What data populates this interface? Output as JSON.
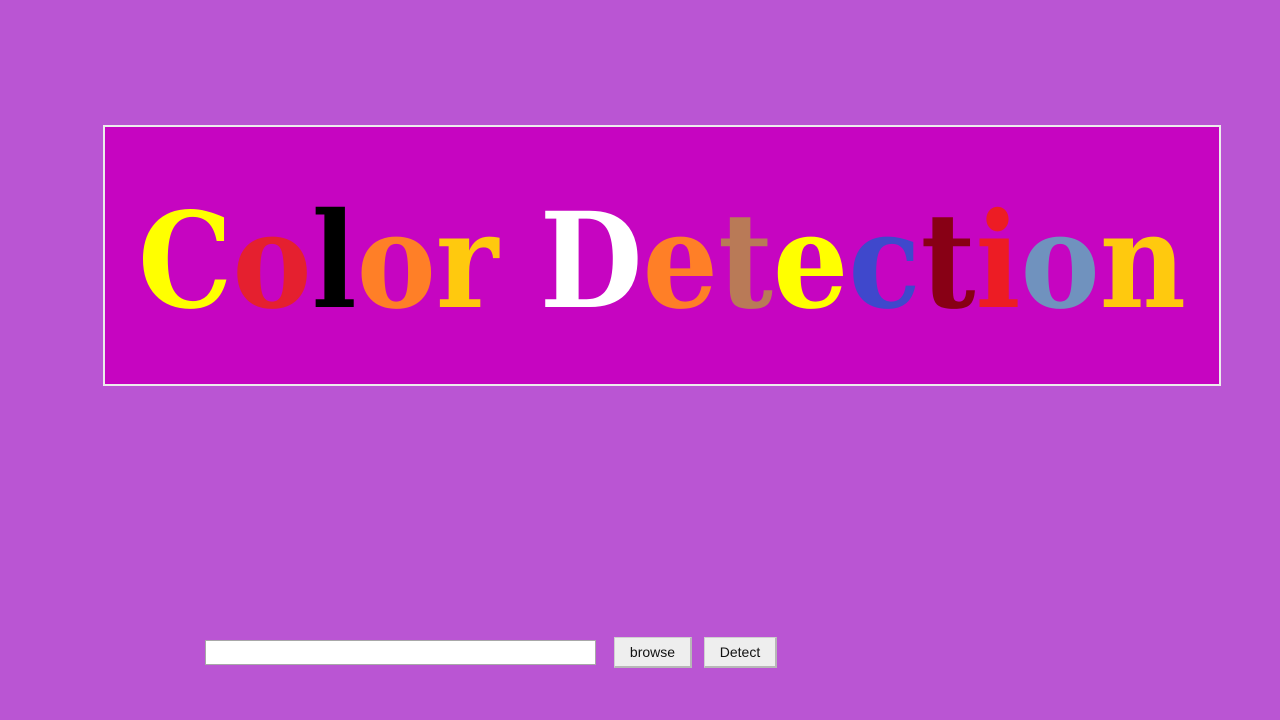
{
  "banner": {
    "letters": [
      {
        "char": "C",
        "color": "#ffff00"
      },
      {
        "char": "o",
        "color": "#e5202f"
      },
      {
        "char": "l",
        "color": "#000000"
      },
      {
        "char": "o",
        "color": "#ff7f27"
      },
      {
        "char": "r",
        "color": "#ffc90e"
      },
      {
        "char": " ",
        "color": "#ffffff"
      },
      {
        "char": "D",
        "color": "#ffffff"
      },
      {
        "char": "e",
        "color": "#ff7f27"
      },
      {
        "char": "t",
        "color": "#b97a57"
      },
      {
        "char": "e",
        "color": "#ffff00"
      },
      {
        "char": "c",
        "color": "#3f48cc"
      },
      {
        "char": "t",
        "color": "#880015"
      },
      {
        "char": "i",
        "color": "#ed1c24"
      },
      {
        "char": "o",
        "color": "#7092be"
      },
      {
        "char": "n",
        "color": "#ffc90e"
      }
    ],
    "background_color": "#c605c1",
    "border_color": "#ececec"
  },
  "window": {
    "background_color": "#ba55d3"
  },
  "file_input": {
    "value": "",
    "placeholder": ""
  },
  "buttons": {
    "browse_label": "browse",
    "detect_label": "Detect"
  }
}
